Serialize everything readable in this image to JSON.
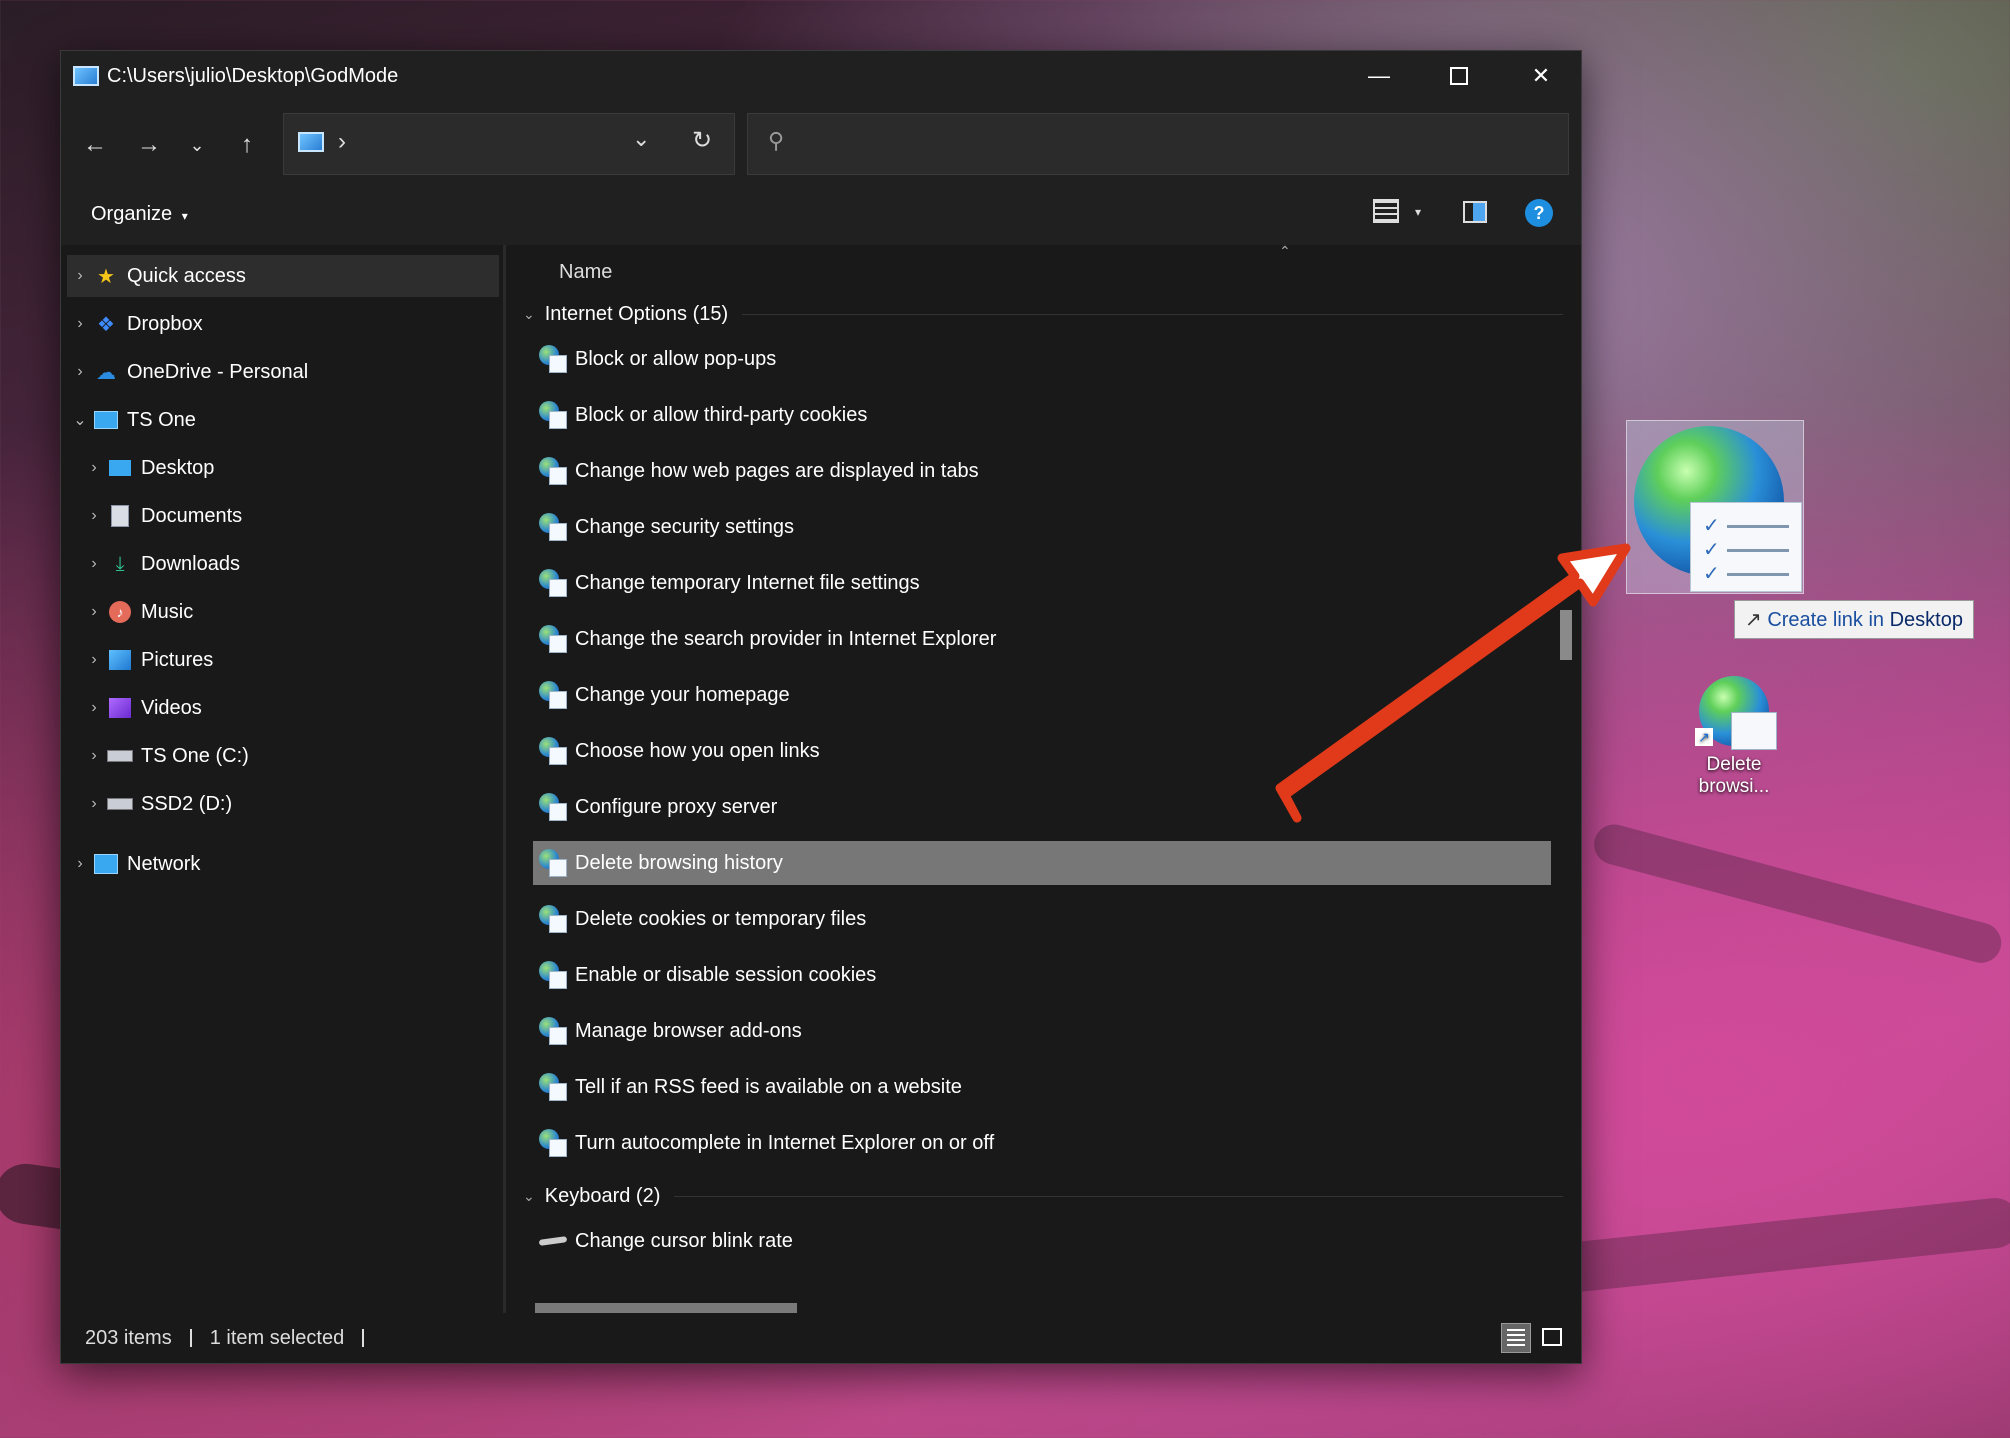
{
  "window": {
    "title": "C:\\Users\\julio\\Desktop\\GodMode"
  },
  "toolbar": {
    "organize_label": "Organize",
    "address_separator": "›"
  },
  "sidebar": {
    "items": [
      {
        "label": "Quick access",
        "icon": "star-icon"
      },
      {
        "label": "Dropbox",
        "icon": "dropbox-icon"
      },
      {
        "label": "OneDrive - Personal",
        "icon": "cloud-icon"
      },
      {
        "label": "TS One",
        "icon": "computer-icon"
      },
      {
        "label": "Desktop",
        "icon": "desktop-icon"
      },
      {
        "label": "Documents",
        "icon": "documents-icon"
      },
      {
        "label": "Downloads",
        "icon": "download-icon"
      },
      {
        "label": "Music",
        "icon": "music-icon"
      },
      {
        "label": "Pictures",
        "icon": "pictures-icon"
      },
      {
        "label": "Videos",
        "icon": "videos-icon"
      },
      {
        "label": "TS One (C:)",
        "icon": "drive-icon"
      },
      {
        "label": "SSD2 (D:)",
        "icon": "drive-icon"
      },
      {
        "label": "Network",
        "icon": "network-icon"
      }
    ]
  },
  "content": {
    "column_name": "Name",
    "groups": [
      {
        "title": "Internet Options (15)",
        "items": [
          "Block or allow pop-ups",
          "Block or allow third-party cookies",
          "Change how web pages are displayed in tabs",
          "Change security settings",
          "Change temporary Internet file settings",
          "Change the search provider in Internet Explorer",
          "Change your homepage",
          "Choose how you open links",
          "Configure proxy server",
          "Delete browsing history",
          "Delete cookies or temporary files",
          "Enable or disable session cookies",
          "Manage browser add-ons",
          "Tell if an RSS feed is available on a website",
          "Turn autocomplete in Internet Explorer on or off"
        ]
      },
      {
        "title": "Keyboard (2)",
        "items": [
          "Change cursor blink rate"
        ]
      }
    ],
    "selected_item": "Delete browsing history"
  },
  "status": {
    "item_count": "203 items",
    "selection": "1 item selected"
  },
  "desktop": {
    "drag_tooltip_prefix": "Create link in ",
    "drag_tooltip_target": "Desktop",
    "shortcut_label_line1": "Delete",
    "shortcut_label_line2": "browsi..."
  },
  "colors": {
    "arrow": "#e03a1a",
    "selection": "#777777",
    "help": "#1e8fe0"
  }
}
